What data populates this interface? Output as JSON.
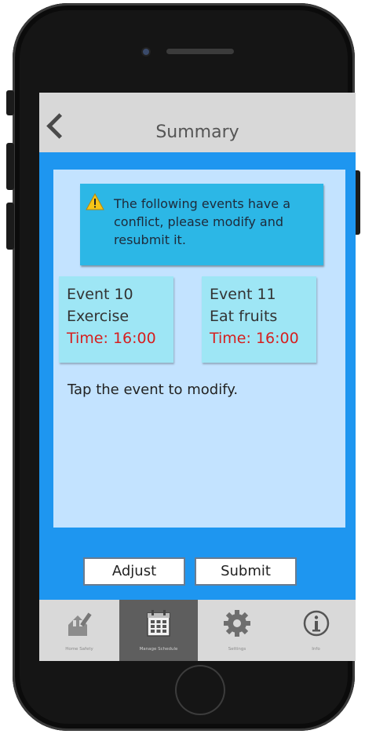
{
  "header": {
    "title": "Summary"
  },
  "warning": {
    "text": "The following events have a conflict, please modify and resubmit it."
  },
  "events": [
    {
      "name": "Event 10",
      "activity": "Exercise",
      "time": "Time: 16:00"
    },
    {
      "name": "Event 11",
      "activity": "Eat fruits",
      "time": "Time: 16:00"
    }
  ],
  "hint": "Tap the event to modify.",
  "actions": {
    "adjust": "Adjust",
    "submit": "Submit"
  },
  "tabs": [
    {
      "label": "Home Safety",
      "icon": "home-safety-icon"
    },
    {
      "label": "Manage Schedule",
      "icon": "calendar-icon",
      "active": true
    },
    {
      "label": "Settings",
      "icon": "gear-icon"
    },
    {
      "label": "Info",
      "icon": "info-icon"
    }
  ],
  "colors": {
    "screen_background": "#1e96f0",
    "panel": "#c3e3ff",
    "warning_box": "#2cb7e6",
    "event_card": "#9ee6f5",
    "time_text": "#d61f1f",
    "tabbar": "#d9d9d9",
    "tab_active": "#5e5e5e"
  }
}
